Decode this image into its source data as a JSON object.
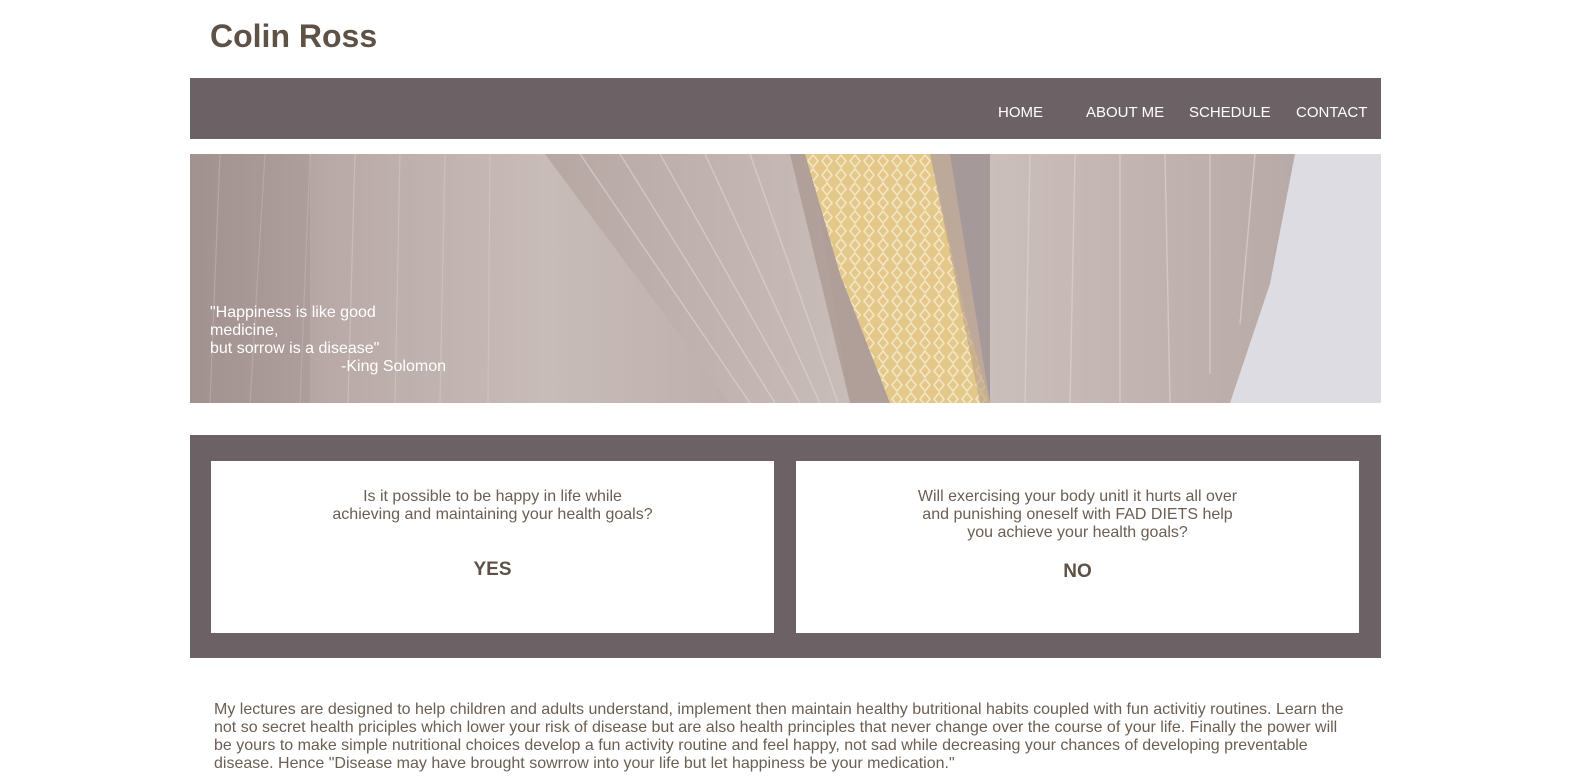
{
  "site": {
    "title": "Colin Ross"
  },
  "nav": {
    "items": [
      {
        "label": "HOME"
      },
      {
        "label": "ABOUT ME"
      },
      {
        "label": "SCHEDULE"
      },
      {
        "label": "CONTACT"
      }
    ]
  },
  "hero": {
    "quote_line1": "\"Happiness is like good medicine,",
    "quote_line2": "but sorrow is a disease\"",
    "author": "-King Solomon"
  },
  "cards": [
    {
      "question_line1": "Is it possible to be happy in life while",
      "question_line2": "achieving and maintaining your health goals?",
      "answer": "YES"
    },
    {
      "question_line1": "Will exercising your body unitl it hurts all over",
      "question_line2": "and punishing oneself with FAD DIETS help",
      "question_line3": "you achieve your health goals?",
      "answer": "NO"
    }
  ],
  "intro": {
    "text": "My lectures are designed to help children and adults understand, implement then maintain healthy butritional habits coupled with fun activitiy routines. Learn the not so secret health priciples which lower your risk of disease but are also health principles that never change over the course of your life. Finally the power will be yours to make simple nutritional choices develop a fun activity routine and feel happy, not sad while decreasing your chances of developing preventable disease. Hence \"Disease may have brought sowrrow into your life but let happiness be your medication.\""
  },
  "colors": {
    "brand_brown": "#5e5146",
    "nav_bg": "#6c6265",
    "text_brown": "#6b5e52",
    "tie_gold": "#e2c37e"
  }
}
